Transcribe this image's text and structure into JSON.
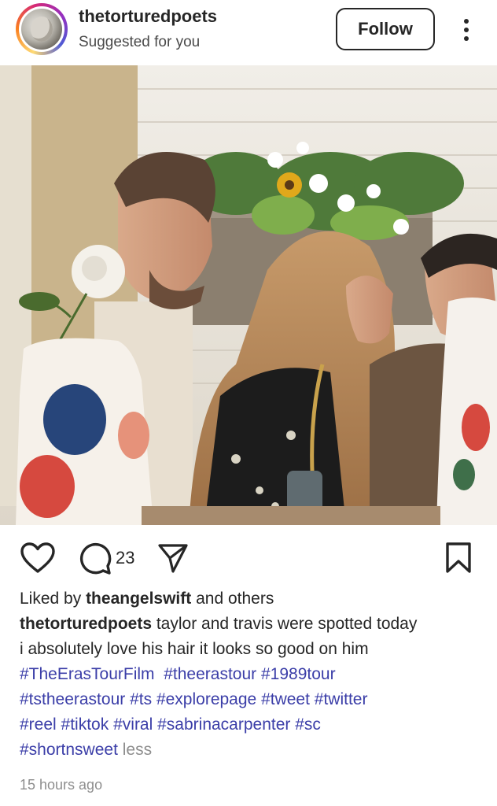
{
  "post": {
    "username": "thetorturedpoets",
    "subtitle": "Suggested for you",
    "follow_label": "Follow",
    "comment_count": "23",
    "liked_by_prefix": "Liked by",
    "liked_by_user": "theangelswift",
    "liked_by_suffix": "and others",
    "caption_user": "thetorturedpoets",
    "caption_line1": "taylor and travis were spotted today",
    "caption_line2": "i absolutely love his hair it looks so good on him",
    "hashtags": [
      "#TheErasTourFilm",
      "#theerastour",
      "#1989tour",
      "#tstheerastour",
      "#ts",
      "#explorepage",
      "#tweet",
      "#twitter",
      "#reel",
      "#tiktok",
      "#viral",
      "#sabrinacarpenter",
      "#sc",
      "#shortnsweet"
    ],
    "less_label": "less",
    "timestamp": "15 hours ago"
  },
  "icons": {
    "like": "heart-icon",
    "comment": "comment-icon",
    "share": "paper-plane-icon",
    "save": "bookmark-icon",
    "more": "more-vertical-icon"
  },
  "colors": {
    "text": "#262626",
    "hashtag": "#3b3ea8",
    "muted": "#8e8e8e",
    "story_ring": [
      "#feda75",
      "#fa7e1e",
      "#d62976",
      "#962fbf",
      "#4f5bd5"
    ]
  }
}
